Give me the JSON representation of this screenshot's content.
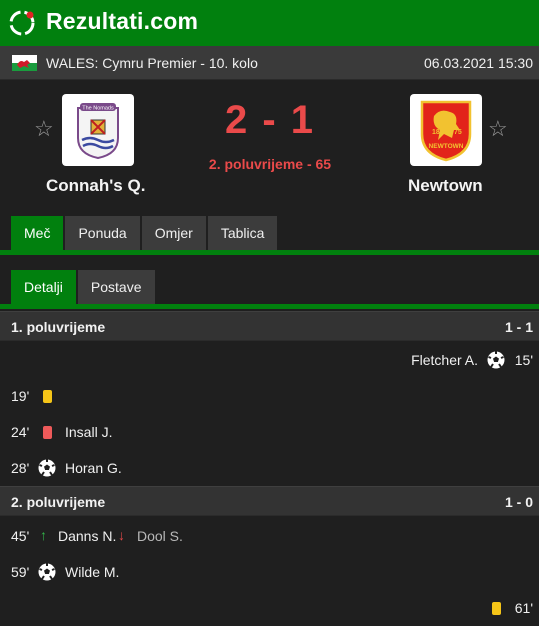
{
  "brand": {
    "name": "Rezultati.com",
    "logo_icon": "soccer-swirl-icon"
  },
  "match_header": {
    "league": "WALES: Cymru Premier - 10. kolo",
    "flag_icon": "wales-flag-icon",
    "datetime": "06.03.2021 15:30"
  },
  "home": {
    "name": "Connah's Q.",
    "logo_text": "The Nomads"
  },
  "away": {
    "name": "Newtown",
    "logo_text": "NEWTOWN",
    "logo_year_left": "18",
    "logo_year_right": "75"
  },
  "score": {
    "display": "2 - 1",
    "home": 2,
    "away": 1,
    "status": "2. poluvrijeme - 65"
  },
  "tabs": [
    {
      "label": "Meč",
      "active": true
    },
    {
      "label": "Ponuda",
      "active": false
    },
    {
      "label": "Omjer",
      "active": false
    },
    {
      "label": "Tablica",
      "active": false
    }
  ],
  "subtabs": [
    {
      "label": "Detalji",
      "active": true
    },
    {
      "label": "Postave",
      "active": false
    }
  ],
  "sections": [
    {
      "title": "1. poluvrijeme",
      "score": "1 - 1",
      "events": [
        {
          "side": "away",
          "minute": "15'",
          "type": "goal",
          "player": "Fletcher A."
        },
        {
          "side": "home",
          "minute": "19'",
          "type": "yellow-card",
          "player": ""
        },
        {
          "side": "home",
          "minute": "24'",
          "type": "red-card",
          "player": "Insall J."
        },
        {
          "side": "home",
          "minute": "28'",
          "type": "goal",
          "player": "Horan G."
        }
      ]
    },
    {
      "title": "2. poluvrijeme",
      "score": "1 - 0",
      "events": [
        {
          "side": "home",
          "minute": "45'",
          "type": "substitution",
          "player_in": "Danns N.",
          "player_out": "Dool S."
        },
        {
          "side": "home",
          "minute": "59'",
          "type": "goal",
          "player": "Wilde M."
        },
        {
          "side": "away",
          "minute": "61'",
          "type": "yellow-card",
          "player": ""
        }
      ]
    }
  ],
  "colors": {
    "accent": "#01800e",
    "score": "#ea4a4a",
    "yellow_card": "#f5c518",
    "red_card": "#ee5a5a"
  }
}
